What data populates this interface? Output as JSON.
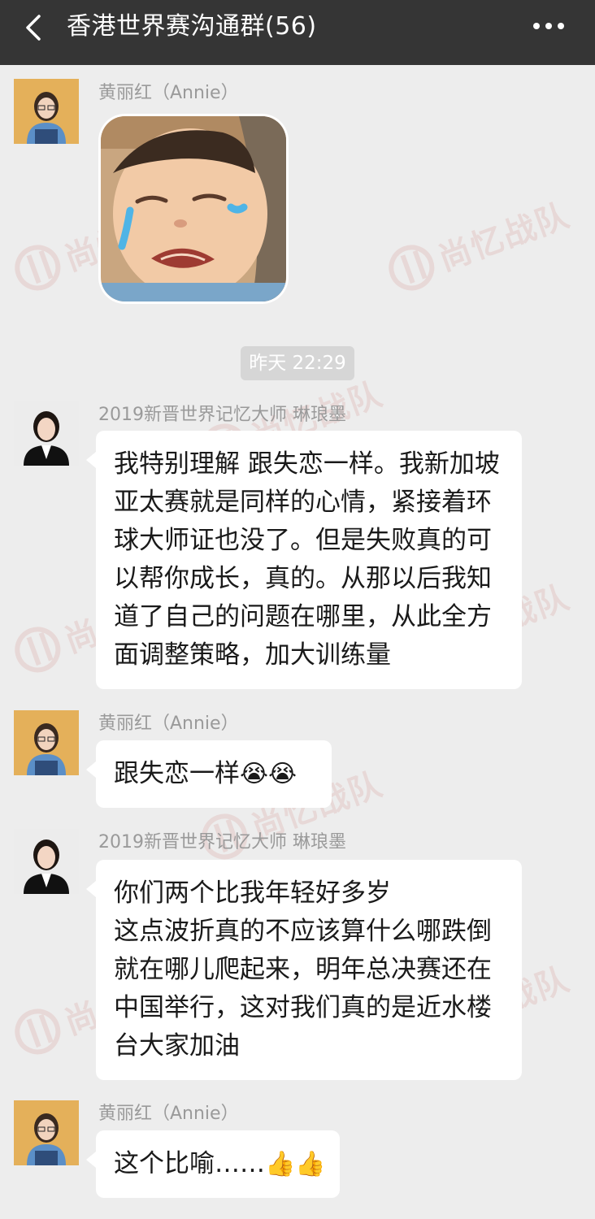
{
  "header": {
    "title": "香港世界赛沟通群(56)"
  },
  "watermark": {
    "text": "尚忆战队"
  },
  "divider": {
    "timestamp": "昨天 22:29"
  },
  "messages": [
    {
      "sender": "黄丽红（Annie）",
      "type": "sticker",
      "sticker": "crying-child-sticker"
    },
    {
      "sender": "2019新晋世界记忆大师 琳琅墨",
      "type": "text",
      "lines": [
        "我特别理解 跟失恋一样。我新加坡",
        "亚太赛就是同样的心情，紧接着环",
        "球大师证也没了。但是失败真的可",
        "以帮你成长，真的。从那以后我知",
        "道了自己的问题在哪里，从此全方",
        "面调整策略，加大训练量"
      ]
    },
    {
      "sender": "黄丽红（Annie）",
      "type": "text",
      "text": "跟失恋一样",
      "emoji": "😭😭"
    },
    {
      "sender": "2019新晋世界记忆大师 琳琅墨",
      "type": "text",
      "lines": [
        "你们两个比我年轻好多岁",
        "这点波折真的不应该算什么哪跌倒",
        "就在哪儿爬起来，明年总决赛还在",
        "中国举行，这对我们真的是近水楼",
        "台大家加油"
      ]
    },
    {
      "sender": "黄丽红（Annie）",
      "type": "text",
      "text": "这个比喻……",
      "emoji": "👍👍"
    }
  ],
  "colors": {
    "header_bg": "#353535",
    "chat_bg": "#ededed",
    "bubble_bg": "#ffffff",
    "nickname": "#9a9a9a",
    "watermark": "#c0392b"
  }
}
